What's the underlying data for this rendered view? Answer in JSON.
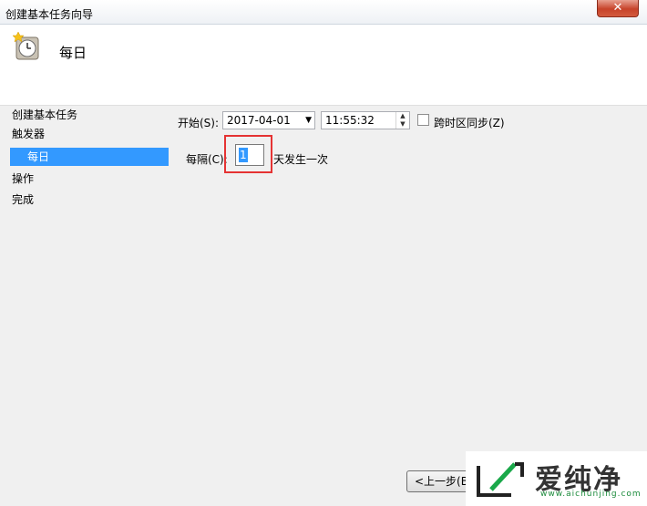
{
  "window": {
    "title": "创建基本任务向导",
    "close_glyph": "✕"
  },
  "header": {
    "heading": "每日"
  },
  "nav": {
    "items": [
      {
        "label": "创建基本任务"
      },
      {
        "label": "触发器"
      },
      {
        "label": "每日"
      },
      {
        "label": "操作"
      },
      {
        "label": "完成"
      }
    ]
  },
  "form": {
    "start_label": "开始(S):",
    "start_date": "2017-04-01",
    "start_time": "11:55:32",
    "sync_label": "跨时区同步(Z)",
    "every_label": "每隔(C):",
    "every_value": "1",
    "every_suffix": "天发生一次"
  },
  "buttons": {
    "back": "<上一步(B"
  },
  "watermark": {
    "brand": "爱纯净",
    "url": "www.aichunjing.com"
  }
}
